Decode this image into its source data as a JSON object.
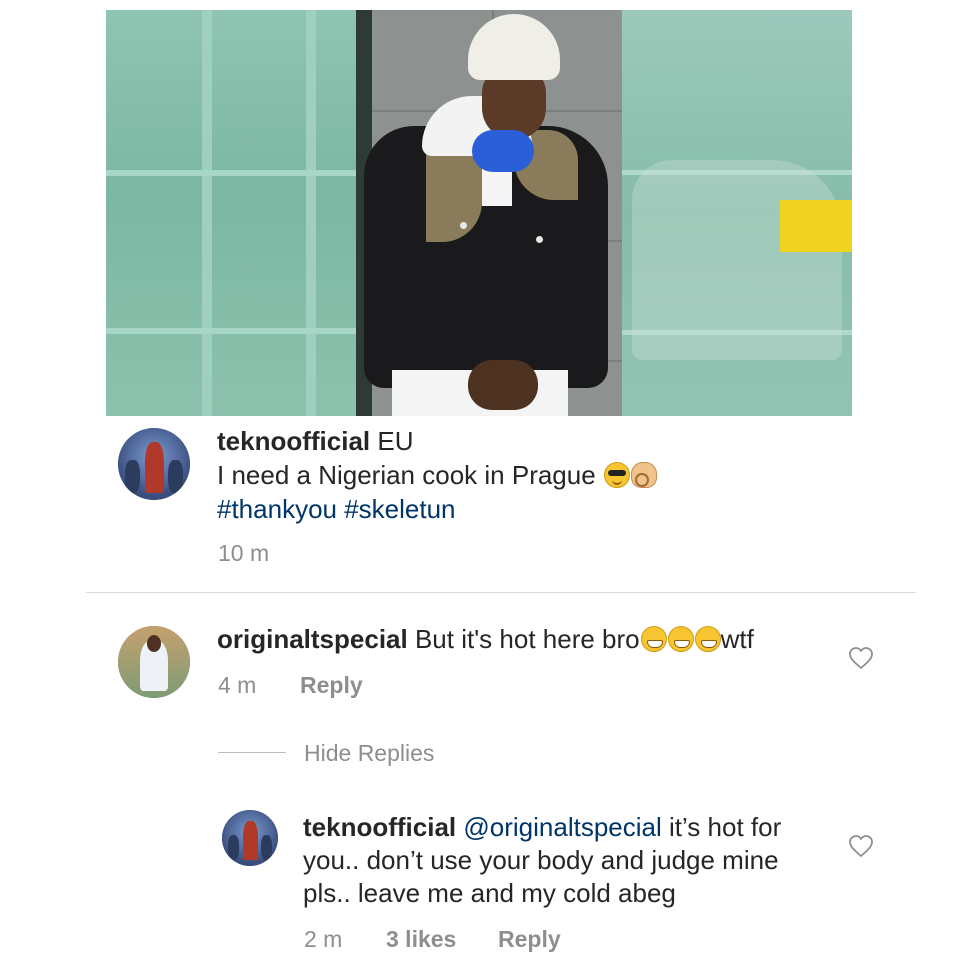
{
  "post": {
    "username": "teknoofficial",
    "location_text": "EU",
    "caption": "I need a Nigerian cook in Prague",
    "hashtags": "#thankyou #skeletun",
    "time": "10 m",
    "emojis": [
      "sunglasses-face",
      "ok-hand"
    ]
  },
  "comments": [
    {
      "username": "originaltspecial",
      "text": "But it's hot here bro",
      "text_tail": "wtf",
      "emojis": [
        "grinning-face",
        "grinning-face",
        "grinning-face"
      ],
      "time": "4 m",
      "reply_label": "Reply",
      "like_icon": "heart-outline-icon"
    }
  ],
  "replies_toggle": "Hide Replies",
  "reply": {
    "username": "teknoofficial",
    "mention": "@originaltspecial",
    "line1_tail": "it’s hot for",
    "line2": "you.. don’t use your body and judge mine",
    "line3": "pls.. leave me and my cold abeg",
    "time": "2 m",
    "likes": "3 likes",
    "reply_label": "Reply",
    "like_icon": "heart-outline-icon"
  },
  "colors": {
    "text": "#262626",
    "meta": "#8e8e8e",
    "link": "#003569",
    "divider": "#dbdbdb"
  }
}
